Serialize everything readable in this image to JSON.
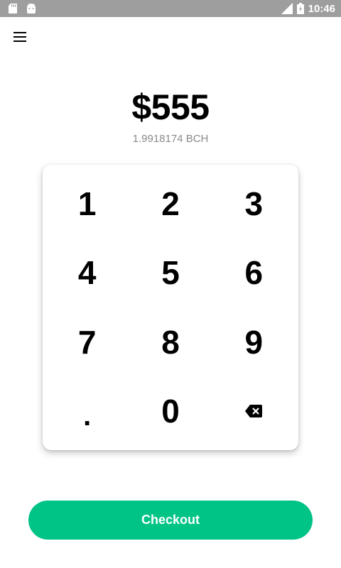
{
  "status_bar": {
    "network": "LTE",
    "time": "10:46"
  },
  "icons": {
    "menu": "menu-icon",
    "backspace": "backspace-icon"
  },
  "amount": {
    "fiat": "$555",
    "crypto": "1.9918174 BCH"
  },
  "keypad": {
    "keys": [
      "1",
      "2",
      "3",
      "4",
      "5",
      "6",
      "7",
      "8",
      "9",
      ".",
      "0"
    ]
  },
  "checkout": {
    "label": "Checkout"
  },
  "colors": {
    "accent": "#00c386",
    "status_bar": "#9e9e9e"
  }
}
